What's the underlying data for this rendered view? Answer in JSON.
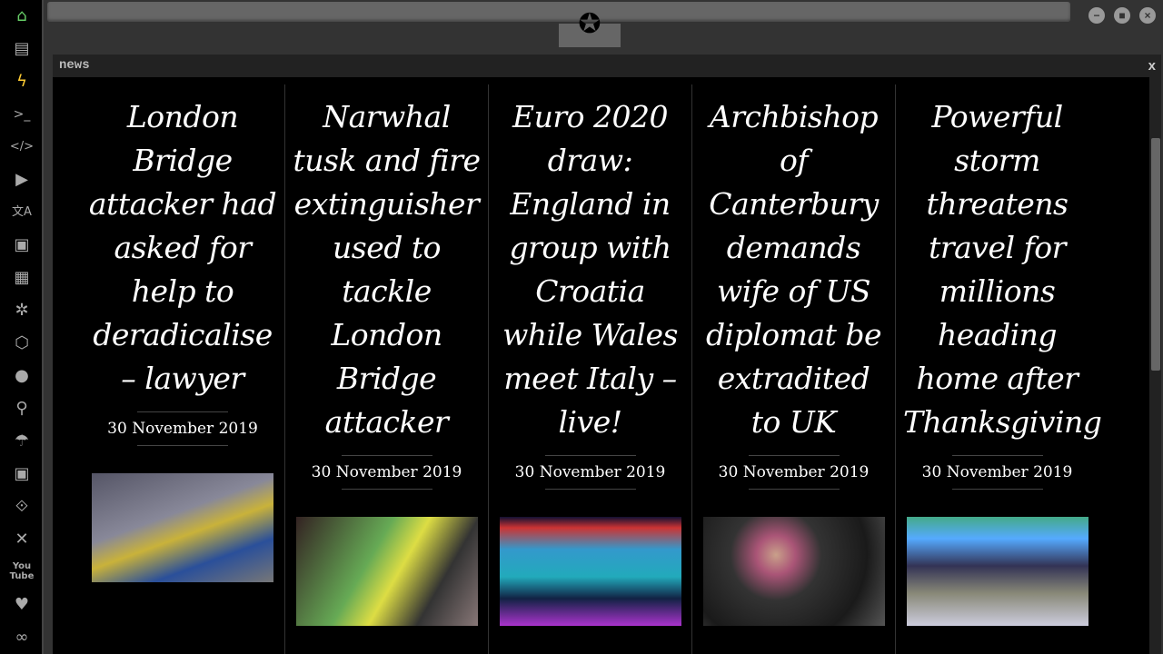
{
  "sidebar": {
    "icons": [
      "home-icon",
      "document-icon",
      "lightning-icon",
      "terminal-icon",
      "code-icon",
      "play-icon",
      "translate-icon",
      "image-icon",
      "newspaper-icon",
      "rebel-emblem-icon",
      "hexagon-network-icon",
      "globe-icon",
      "search-icon",
      "umbrella-icon",
      "contacts-icon",
      "link-icon",
      "expand-icon",
      "youtube-icon",
      "heart-icon",
      "infinity-cloud-icon"
    ]
  },
  "panel": {
    "title": "news",
    "close": "x"
  },
  "window": {
    "minimize": "−",
    "maximize": "■",
    "close": "×"
  },
  "articles": [
    {
      "headline": "London Bridge attacker had asked for help to deradicalise – lawyer",
      "date": "30 November 2019"
    },
    {
      "headline": "Narwhal tusk and fire extinguisher used to tackle London Bridge attacker",
      "date": "30 November 2019"
    },
    {
      "headline": "Euro 2020 draw: England in group with Croatia while Wales meet Italy – live!",
      "date": "30 November 2019"
    },
    {
      "headline": "Archbishop of Canterbury demands wife of US diplomat be extradited to UK",
      "date": "30 November 2019"
    },
    {
      "headline": "Powerful storm threatens travel for millions heading home after Thanksgiving",
      "date": "30 November 2019"
    }
  ]
}
